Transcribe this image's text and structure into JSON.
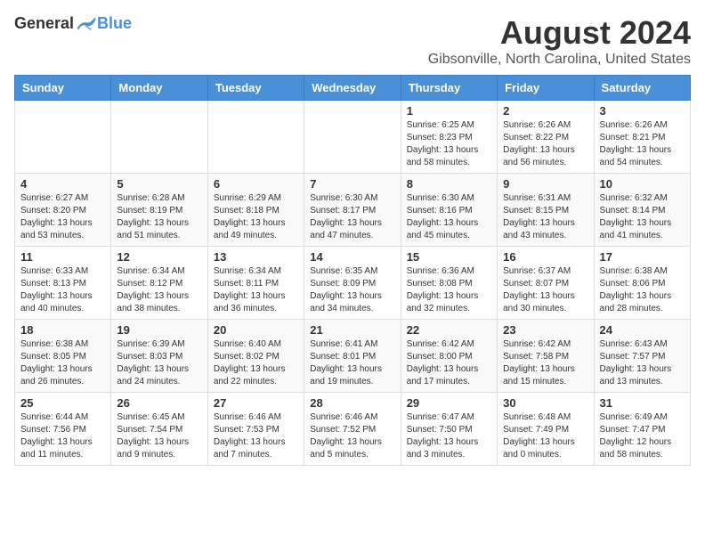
{
  "logo": {
    "general": "General",
    "blue": "Blue"
  },
  "title": "August 2024",
  "location": "Gibsonville, North Carolina, United States",
  "days_of_week": [
    "Sunday",
    "Monday",
    "Tuesday",
    "Wednesday",
    "Thursday",
    "Friday",
    "Saturday"
  ],
  "weeks": [
    [
      {
        "day": "",
        "info": ""
      },
      {
        "day": "",
        "info": ""
      },
      {
        "day": "",
        "info": ""
      },
      {
        "day": "",
        "info": ""
      },
      {
        "day": "1",
        "info": "Sunrise: 6:25 AM\nSunset: 8:23 PM\nDaylight: 13 hours\nand 58 minutes."
      },
      {
        "day": "2",
        "info": "Sunrise: 6:26 AM\nSunset: 8:22 PM\nDaylight: 13 hours\nand 56 minutes."
      },
      {
        "day": "3",
        "info": "Sunrise: 6:26 AM\nSunset: 8:21 PM\nDaylight: 13 hours\nand 54 minutes."
      }
    ],
    [
      {
        "day": "4",
        "info": "Sunrise: 6:27 AM\nSunset: 8:20 PM\nDaylight: 13 hours\nand 53 minutes."
      },
      {
        "day": "5",
        "info": "Sunrise: 6:28 AM\nSunset: 8:19 PM\nDaylight: 13 hours\nand 51 minutes."
      },
      {
        "day": "6",
        "info": "Sunrise: 6:29 AM\nSunset: 8:18 PM\nDaylight: 13 hours\nand 49 minutes."
      },
      {
        "day": "7",
        "info": "Sunrise: 6:30 AM\nSunset: 8:17 PM\nDaylight: 13 hours\nand 47 minutes."
      },
      {
        "day": "8",
        "info": "Sunrise: 6:30 AM\nSunset: 8:16 PM\nDaylight: 13 hours\nand 45 minutes."
      },
      {
        "day": "9",
        "info": "Sunrise: 6:31 AM\nSunset: 8:15 PM\nDaylight: 13 hours\nand 43 minutes."
      },
      {
        "day": "10",
        "info": "Sunrise: 6:32 AM\nSunset: 8:14 PM\nDaylight: 13 hours\nand 41 minutes."
      }
    ],
    [
      {
        "day": "11",
        "info": "Sunrise: 6:33 AM\nSunset: 8:13 PM\nDaylight: 13 hours\nand 40 minutes."
      },
      {
        "day": "12",
        "info": "Sunrise: 6:34 AM\nSunset: 8:12 PM\nDaylight: 13 hours\nand 38 minutes."
      },
      {
        "day": "13",
        "info": "Sunrise: 6:34 AM\nSunset: 8:11 PM\nDaylight: 13 hours\nand 36 minutes."
      },
      {
        "day": "14",
        "info": "Sunrise: 6:35 AM\nSunset: 8:09 PM\nDaylight: 13 hours\nand 34 minutes."
      },
      {
        "day": "15",
        "info": "Sunrise: 6:36 AM\nSunset: 8:08 PM\nDaylight: 13 hours\nand 32 minutes."
      },
      {
        "day": "16",
        "info": "Sunrise: 6:37 AM\nSunset: 8:07 PM\nDaylight: 13 hours\nand 30 minutes."
      },
      {
        "day": "17",
        "info": "Sunrise: 6:38 AM\nSunset: 8:06 PM\nDaylight: 13 hours\nand 28 minutes."
      }
    ],
    [
      {
        "day": "18",
        "info": "Sunrise: 6:38 AM\nSunset: 8:05 PM\nDaylight: 13 hours\nand 26 minutes."
      },
      {
        "day": "19",
        "info": "Sunrise: 6:39 AM\nSunset: 8:03 PM\nDaylight: 13 hours\nand 24 minutes."
      },
      {
        "day": "20",
        "info": "Sunrise: 6:40 AM\nSunset: 8:02 PM\nDaylight: 13 hours\nand 22 minutes."
      },
      {
        "day": "21",
        "info": "Sunrise: 6:41 AM\nSunset: 8:01 PM\nDaylight: 13 hours\nand 19 minutes."
      },
      {
        "day": "22",
        "info": "Sunrise: 6:42 AM\nSunset: 8:00 PM\nDaylight: 13 hours\nand 17 minutes."
      },
      {
        "day": "23",
        "info": "Sunrise: 6:42 AM\nSunset: 7:58 PM\nDaylight: 13 hours\nand 15 minutes."
      },
      {
        "day": "24",
        "info": "Sunrise: 6:43 AM\nSunset: 7:57 PM\nDaylight: 13 hours\nand 13 minutes."
      }
    ],
    [
      {
        "day": "25",
        "info": "Sunrise: 6:44 AM\nSunset: 7:56 PM\nDaylight: 13 hours\nand 11 minutes."
      },
      {
        "day": "26",
        "info": "Sunrise: 6:45 AM\nSunset: 7:54 PM\nDaylight: 13 hours\nand 9 minutes."
      },
      {
        "day": "27",
        "info": "Sunrise: 6:46 AM\nSunset: 7:53 PM\nDaylight: 13 hours\nand 7 minutes."
      },
      {
        "day": "28",
        "info": "Sunrise: 6:46 AM\nSunset: 7:52 PM\nDaylight: 13 hours\nand 5 minutes."
      },
      {
        "day": "29",
        "info": "Sunrise: 6:47 AM\nSunset: 7:50 PM\nDaylight: 13 hours\nand 3 minutes."
      },
      {
        "day": "30",
        "info": "Sunrise: 6:48 AM\nSunset: 7:49 PM\nDaylight: 13 hours\nand 0 minutes."
      },
      {
        "day": "31",
        "info": "Sunrise: 6:49 AM\nSunset: 7:47 PM\nDaylight: 12 hours\nand 58 minutes."
      }
    ]
  ]
}
